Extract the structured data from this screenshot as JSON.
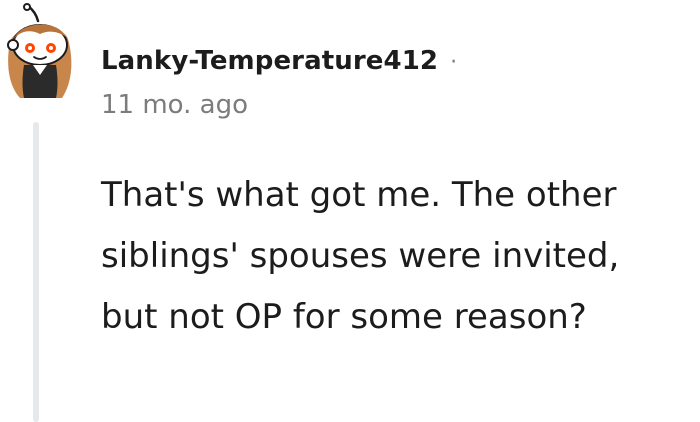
{
  "comment": {
    "author": "Lanky-Temperature412",
    "separator": "·",
    "timestamp": "11 mo. ago",
    "body": "That's what got me. The other siblings' spouses were invited, but not OP for some reason?",
    "avatar_icon": "snoo-avatar-icon",
    "thread_line_color": "#e6e9eb"
  }
}
